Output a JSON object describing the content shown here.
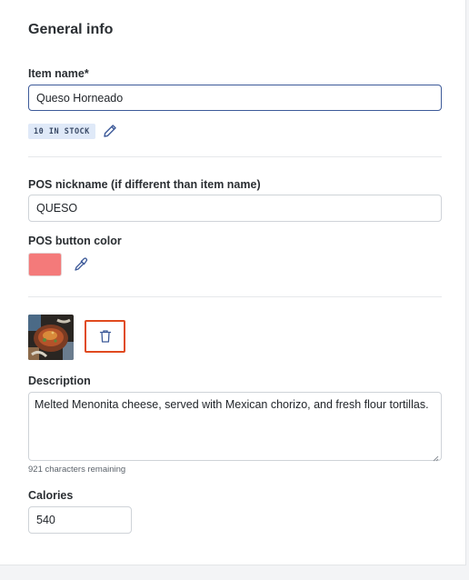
{
  "section": {
    "title": "General info"
  },
  "item_name": {
    "label": "Item name*",
    "value": "Queso Horneado"
  },
  "stock": {
    "badge": "10 IN STOCK",
    "edit_icon": "pencil-icon"
  },
  "pos_nickname": {
    "label": "POS nickname (if different than item name)",
    "value": "QUESO"
  },
  "pos_color": {
    "label": "POS button color",
    "color": "#f47a7a",
    "picker_icon": "eyedropper-icon"
  },
  "image": {
    "delete_icon": "trash-icon",
    "delete_highlight": "#e04a1f"
  },
  "description": {
    "label": "Description",
    "value": "Melted Menonita cheese, served with Mexican chorizo, and fresh flour tortillas.",
    "helper": "921 characters remaining"
  },
  "calories": {
    "label": "Calories",
    "value": "540"
  },
  "colors": {
    "accent": "#3d5a99",
    "badge_bg": "#dfe9f8"
  }
}
